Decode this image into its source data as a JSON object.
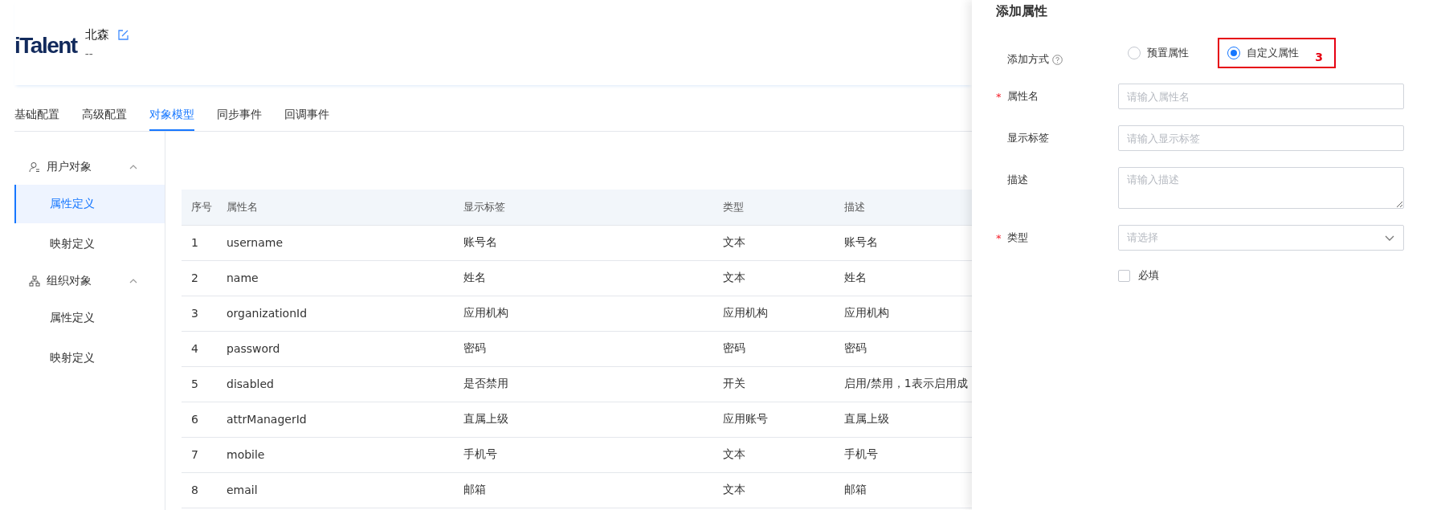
{
  "header": {
    "logo": "iTalent",
    "title": "北森",
    "subtitle": "--"
  },
  "tabs": [
    {
      "label": "基础配置",
      "selected": false
    },
    {
      "label": "高级配置",
      "selected": false
    },
    {
      "label": "对象模型",
      "selected": true
    },
    {
      "label": "同步事件",
      "selected": false
    },
    {
      "label": "回调事件",
      "selected": false
    }
  ],
  "sidebar": {
    "groups": [
      {
        "kind": "user",
        "label": "用户对象",
        "expanded": true,
        "children": [
          {
            "label": "属性定义",
            "selected": true
          },
          {
            "label": "映射定义",
            "selected": false
          }
        ]
      },
      {
        "kind": "org",
        "label": "组织对象",
        "expanded": true,
        "children": [
          {
            "label": "属性定义",
            "selected": false
          },
          {
            "label": "映射定义",
            "selected": false
          }
        ]
      }
    ]
  },
  "table": {
    "columns": [
      "序号",
      "属性名",
      "显示标签",
      "类型",
      "描述"
    ],
    "rows": [
      [
        "1",
        "username",
        "账号名",
        "文本",
        "账号名"
      ],
      [
        "2",
        "name",
        "姓名",
        "文本",
        "姓名"
      ],
      [
        "3",
        "organizationId",
        "应用机构",
        "应用机构",
        "应用机构"
      ],
      [
        "4",
        "password",
        "密码",
        "密码",
        "密码"
      ],
      [
        "5",
        "disabled",
        "是否禁用",
        "开关",
        "启用/禁用，1表示启用成"
      ],
      [
        "6",
        "attrManagerId",
        "直属上级",
        "应用账号",
        "直属上级"
      ],
      [
        "7",
        "mobile",
        "手机号",
        "文本",
        "手机号"
      ],
      [
        "8",
        "email",
        "邮箱",
        "文本",
        "邮箱"
      ]
    ]
  },
  "drawer": {
    "title": "添加属性",
    "add_mode": {
      "label": "添加方式",
      "options": [
        {
          "label": "预置属性",
          "selected": false
        },
        {
          "label": "自定义属性",
          "selected": true
        }
      ],
      "annotation": "3"
    },
    "fields": [
      {
        "kind": "input",
        "label": "属性名",
        "required_mark": "*",
        "placeholder": "请输入属性名"
      },
      {
        "kind": "input",
        "label": "显示标签",
        "placeholder": "请输入显示标签"
      },
      {
        "kind": "textarea",
        "label": "描述",
        "placeholder": "请输入描述"
      },
      {
        "kind": "select",
        "label": "类型",
        "required_mark": "*",
        "placeholder": "请选择"
      }
    ],
    "required_checkbox": {
      "label": "必填",
      "checked": false
    }
  }
}
